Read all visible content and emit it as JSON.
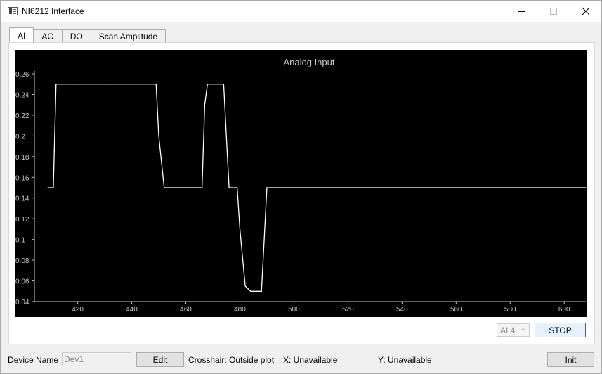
{
  "window": {
    "title": "NI6212 Interface"
  },
  "tabs": [
    {
      "label": "AI",
      "active": true
    },
    {
      "label": "AO",
      "active": false
    },
    {
      "label": "DO",
      "active": false
    },
    {
      "label": "Scan Amplitude",
      "active": false
    }
  ],
  "chart_data": {
    "type": "line",
    "title": "Analog Input",
    "xlabel": "",
    "ylabel": "",
    "xlim": [
      404,
      608
    ],
    "ylim": [
      0.04,
      0.26
    ],
    "xticks": [
      420,
      440,
      460,
      480,
      500,
      520,
      540,
      560,
      580,
      600
    ],
    "yticks": [
      0.04,
      0.06,
      0.08,
      0.1,
      0.12,
      0.14,
      0.16,
      0.18,
      0.2,
      0.22,
      0.24,
      0.26
    ],
    "grid": false,
    "colors": {
      "background": "#000000",
      "line": "#ffffff",
      "axis": "#c8c8c8",
      "title": "#c8c8c8"
    },
    "series": [
      {
        "x": [
          409,
          411,
          412,
          414,
          420,
          430,
          440,
          449,
          450,
          452,
          458,
          466,
          467,
          468,
          470,
          472,
          474,
          475,
          476,
          477,
          479,
          480,
          482,
          484,
          485,
          486,
          487,
          488,
          489,
          490,
          492,
          495,
          500,
          520,
          540,
          560,
          580,
          600,
          608
        ],
        "y": [
          0.15,
          0.15,
          0.25,
          0.25,
          0.25,
          0.25,
          0.25,
          0.25,
          0.2,
          0.15,
          0.15,
          0.15,
          0.23,
          0.25,
          0.25,
          0.25,
          0.25,
          0.2,
          0.15,
          0.15,
          0.15,
          0.11,
          0.055,
          0.05,
          0.05,
          0.05,
          0.05,
          0.05,
          0.1,
          0.15,
          0.15,
          0.15,
          0.15,
          0.15,
          0.15,
          0.15,
          0.15,
          0.15,
          0.15
        ]
      }
    ]
  },
  "controls": {
    "channel_value": "AI 4",
    "stop_label": "STOP"
  },
  "footer": {
    "device_name_label": "Device Name",
    "device_name_value": "Dev1",
    "edit_label": "Edit",
    "crosshair_text": "Crosshair: Outside plot",
    "x_text": "X: Unavailable",
    "y_text": "Y: Unavailable",
    "init_label": "Init"
  },
  "icons": {
    "app": "app-window-icon",
    "minimize": "minimize-icon",
    "maximize": "maximize-icon",
    "close": "close-icon",
    "dropdown": "chevron-down-icon"
  }
}
